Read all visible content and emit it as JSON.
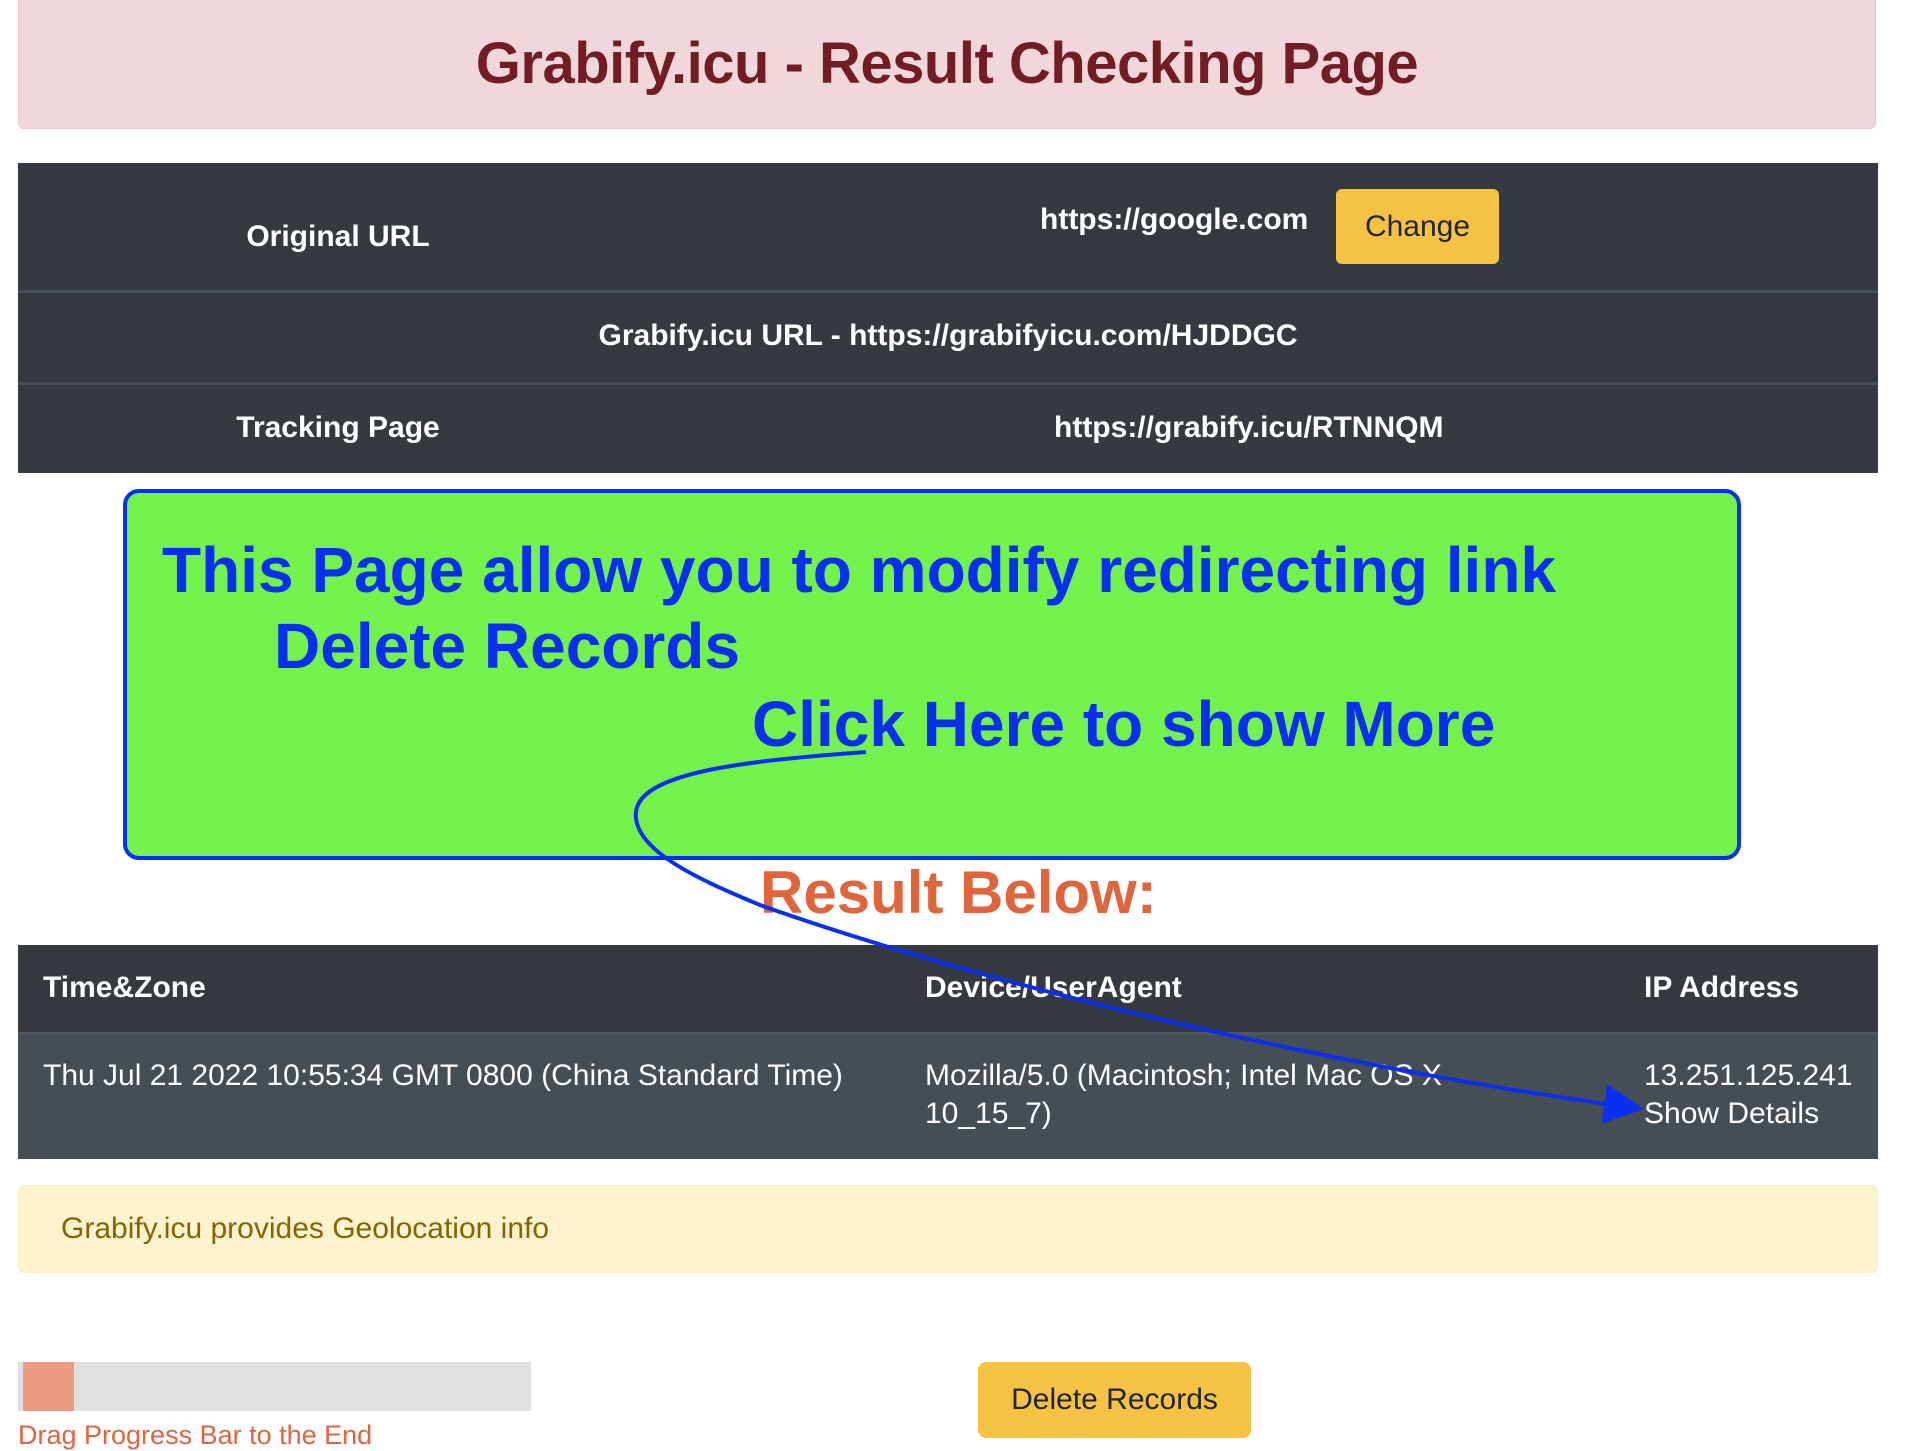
{
  "header": {
    "title": "Grabify.icu - Result Checking Page"
  },
  "info": {
    "original_url_label": "Original URL",
    "original_url_value": "https://google.com",
    "change_label": "Change",
    "grabify_url": "Grabify.icu URL - https://grabifyicu.com/HJDDGC",
    "tracking_label": "Tracking Page",
    "tracking_value": "https://grabify.icu/RTNNQM"
  },
  "annotation": {
    "line1": "This Page allow you to modify redirecting link",
    "line2": "Delete Records",
    "line3": "Click Here to show More",
    "color": "#0a2ff0"
  },
  "result_heading": "Result Below:",
  "results": {
    "headers": [
      "Time&Zone",
      "Device/UserAgent",
      "IP Address"
    ],
    "rows": [
      {
        "time": "Thu Jul 21 2022 10:55:34 GMT 0800 (China Standard Time)",
        "device": "Mozilla/5.0 (Macintosh; Intel Mac OS X 10_15_7)",
        "ip": "13.251.125.241",
        "details": "Show Details"
      }
    ]
  },
  "alert": "Grabify.icu provides Geolocation info",
  "progress": {
    "value_percent": 10,
    "label": "Drag Progress Bar to the End"
  },
  "delete_label": "Delete Records"
}
